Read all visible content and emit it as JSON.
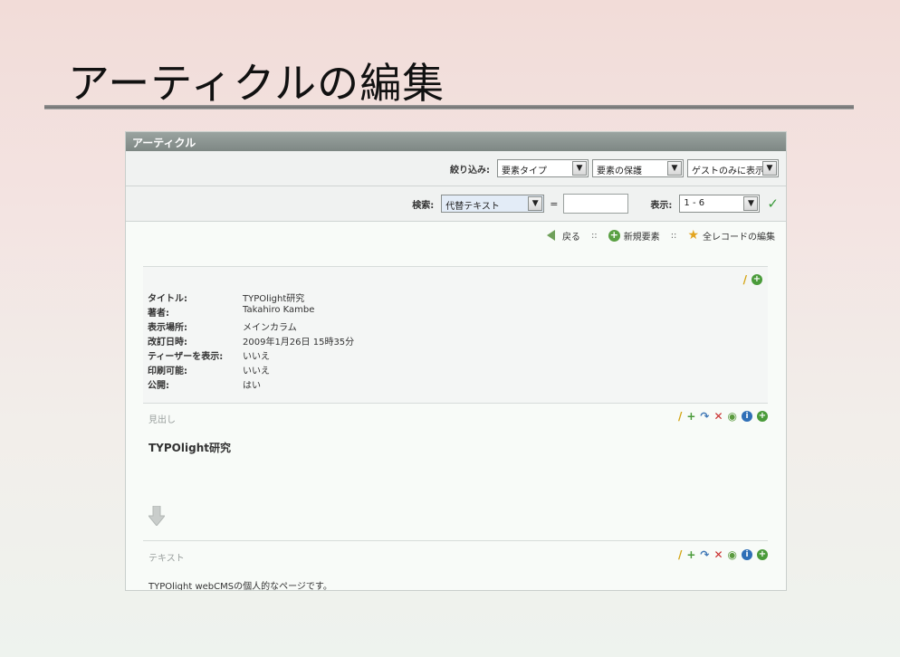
{
  "slide": {
    "title": "アーティクルの編集"
  },
  "window": {
    "header": "アーティクル",
    "filter": {
      "label": "絞り込み:",
      "selects": [
        "要素タイプ",
        "要素の保護",
        "ゲストのみに表示"
      ]
    },
    "search": {
      "label": "検索:",
      "field_select": "代替テキスト",
      "equals": "=",
      "value": "",
      "show_label": "表示:",
      "show_select": "1 - 6"
    },
    "actions": {
      "back": "戻る",
      "sep": "::",
      "new_element": "新規要素",
      "edit_all": "全レコードの編集"
    },
    "meta": {
      "rows": [
        {
          "key": "タイトル:",
          "value": "TYPOlight研究"
        },
        {
          "key": "著者:",
          "value": "Takahiro Kambe"
        },
        {
          "key": "表示場所:",
          "value": "メインカラム"
        },
        {
          "key": "改訂日時:",
          "value": "2009年1月26日 15時35分"
        },
        {
          "key": "ティーザーを表示:",
          "value": "いいえ"
        },
        {
          "key": "印刷可能:",
          "value": "いいえ"
        },
        {
          "key": "公開:",
          "value": "はい"
        }
      ]
    },
    "elements": [
      {
        "type_label": "見出し",
        "content": "TYPOlight研究"
      },
      {
        "type_label": "テキスト",
        "content": "TYPOlight webCMSの個人的なページです。"
      }
    ],
    "colors": {
      "header": "#8a9390",
      "accent_green": "#4a9b3a",
      "delete_red": "#c92c2c",
      "info_blue": "#2f6fb7"
    }
  }
}
